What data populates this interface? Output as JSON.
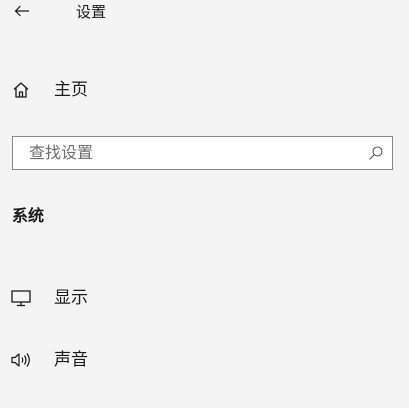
{
  "header": {
    "back_icon": "arrow-left-icon",
    "title": "设置"
  },
  "home": {
    "icon": "home-icon",
    "label": "主页"
  },
  "search": {
    "value": "",
    "placeholder": "查找设置",
    "icon": "search-icon"
  },
  "section": {
    "heading": "系统"
  },
  "nav": {
    "items": [
      {
        "icon": "monitor-icon",
        "label": "显示"
      },
      {
        "icon": "speaker-icon",
        "label": "声音"
      }
    ]
  },
  "colors": {
    "background": "#f4f4f4",
    "text": "#1a1a1a",
    "search_border": "#8a8a8a",
    "placeholder": "#6e6e6e"
  }
}
